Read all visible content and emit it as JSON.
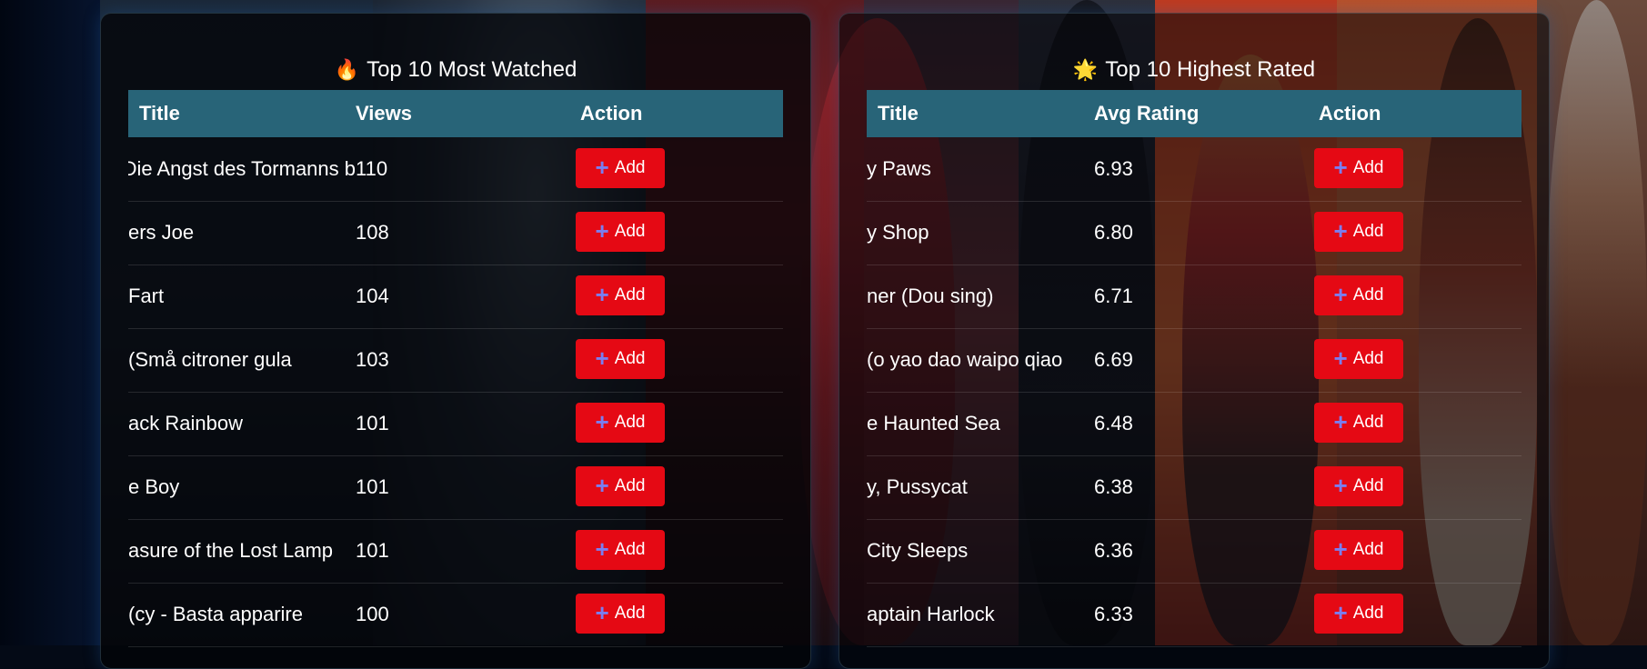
{
  "watched": {
    "emoji": "🔥",
    "title": "Top 10 Most Watched",
    "columns": {
      "title": "Title",
      "value": "Views",
      "action": "Action"
    },
    "button_label": "Add",
    "rows": [
      {
        "title": "Die Angst des Tormanns b",
        "value": "110"
      },
      {
        "title": "ers Joe",
        "value": "108"
      },
      {
        "title": "Fart",
        "value": "104"
      },
      {
        "title": "Små citroner gula)",
        "value": "103"
      },
      {
        "title": "ack Rainbow",
        "value": "101"
      },
      {
        "title": "e Boy",
        "value": "101"
      },
      {
        "title": "asure of the Lost Lamp",
        "value": "101"
      },
      {
        "title": "cy - Basta apparire)",
        "value": "100"
      }
    ]
  },
  "rated": {
    "emoji": "🌟",
    "title": "Top 10 Highest Rated",
    "columns": {
      "title": "Title",
      "value": "Avg Rating",
      "action": "Action"
    },
    "button_label": "Add",
    "rows": [
      {
        "title": "y Paws",
        "value": "6.93"
      },
      {
        "title": "y Shop",
        "value": "6.80"
      },
      {
        "title": "ner (Dou sing)",
        "value": "6.71"
      },
      {
        "title": "o yao dao waipo qiao)",
        "value": "6.69"
      },
      {
        "title": "e Haunted Sea",
        "value": "6.48"
      },
      {
        "title": "y, Pussycat",
        "value": "6.38"
      },
      {
        "title": "City Sleeps",
        "value": "6.36"
      },
      {
        "title": "aptain Harlock",
        "value": "6.33"
      }
    ]
  },
  "colors": {
    "header": "#286478",
    "button": "#e50914",
    "plus_icon": "#7a7ef0"
  }
}
